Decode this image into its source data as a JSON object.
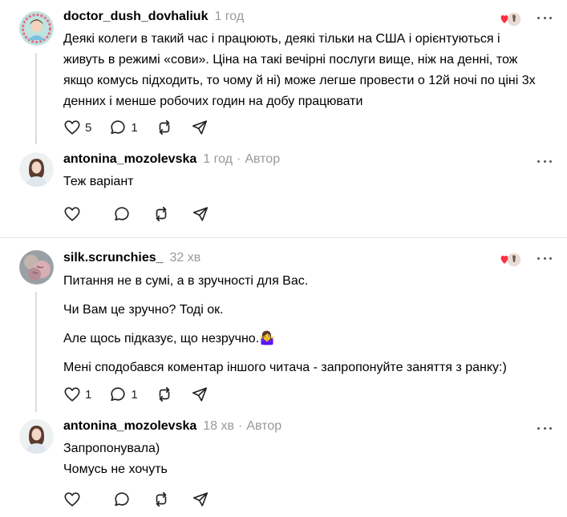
{
  "comments": [
    {
      "username": "doctor_dush_dovhaliuk",
      "time": "1 год",
      "author_tag": "",
      "paragraphs": [
        "Деякі колеги в такий час і працюють, деякі тільки на США і орієнтуються і живуть в режимі «сови». Ціна на такі вечірні послуги вище, ніж на денні, тож якщо комусь підходить, то чому й ні) може легше провести о 12й ночі по ціні 3х денних і менше робочих годин на добу працювати"
      ],
      "like_count": "5",
      "reply_count": "1"
    },
    {
      "username": "antonina_mozolevska",
      "time": "1 год",
      "author_tag": "Автор",
      "paragraphs": [
        "Теж варіант"
      ],
      "like_count": "",
      "reply_count": ""
    },
    {
      "username": "silk.scrunchies_",
      "time": "32 хв",
      "author_tag": "",
      "paragraphs": [
        "Питання не в сумі, а в зручності для Вас.",
        "Чи Вам це зручно? Тоді ок.",
        "Але щось підказує, що незручно.🤷‍♀️",
        "Мені сподобався коментар іншого читача - запропонуйте заняття з ранку:)"
      ],
      "like_count": "1",
      "reply_count": "1"
    },
    {
      "username": "antonina_mozolevska",
      "time": "18 хв",
      "author_tag": "Автор",
      "paragraphs": [
        "Запропонувала)\nЧомусь не хочуть"
      ],
      "like_count": "",
      "reply_count": ""
    }
  ],
  "separator_dot": "·",
  "icons": {
    "like": "heart-icon",
    "reply": "comment-icon",
    "repost": "repost-icon",
    "share": "send-icon",
    "more": "more-icon"
  },
  "colors": {
    "heart_red": "#ff3040",
    "muted": "#999999"
  }
}
